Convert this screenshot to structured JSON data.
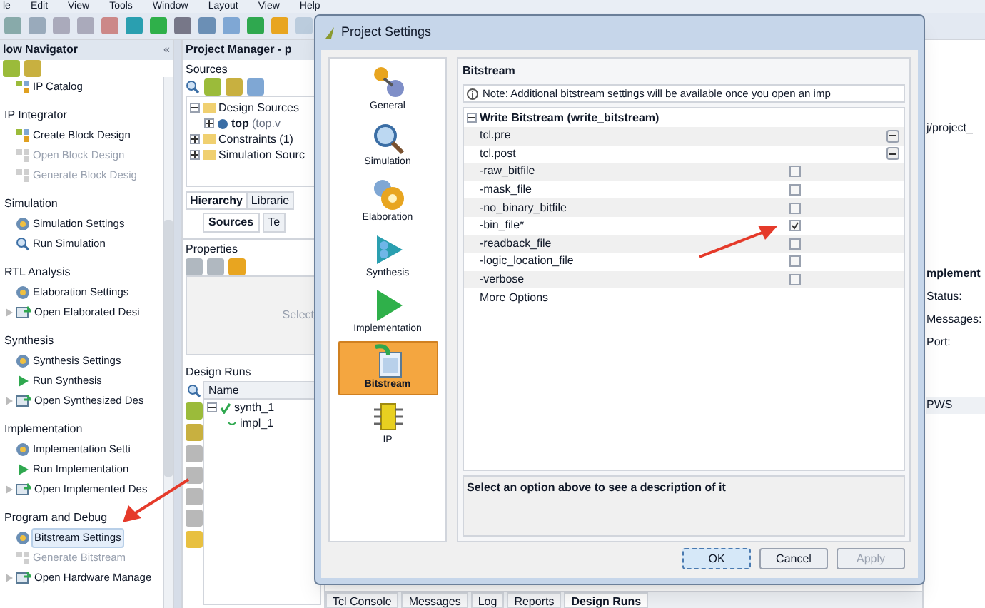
{
  "menu": [
    "le",
    "Edit",
    "View",
    "Tools",
    "Window",
    "Layout",
    "View",
    "Help"
  ],
  "flow_navigator": {
    "title": "low Navigator",
    "collapse": "«",
    "sections": [
      {
        "items": [
          {
            "label": "IP Catalog",
            "kind": "block",
            "disabled": false,
            "selected": false,
            "expandable": false
          }
        ]
      },
      {
        "title": "IP Integrator",
        "items": [
          {
            "label": "Create Block Design",
            "kind": "block",
            "disabled": false,
            "selected": false,
            "expandable": false
          },
          {
            "label": "Open Block Design",
            "kind": "block",
            "disabled": true,
            "selected": false,
            "expandable": false
          },
          {
            "label": "Generate Block Desig",
            "kind": "block",
            "disabled": true,
            "selected": false,
            "expandable": false
          }
        ]
      },
      {
        "title": "Simulation",
        "items": [
          {
            "label": "Simulation Settings",
            "kind": "settings",
            "disabled": false,
            "selected": false,
            "expandable": false
          },
          {
            "label": "Run Simulation",
            "kind": "search",
            "disabled": false,
            "selected": false,
            "expandable": false
          }
        ]
      },
      {
        "title": "RTL Analysis",
        "items": [
          {
            "label": "Elaboration Settings",
            "kind": "settings",
            "disabled": false,
            "selected": false,
            "expandable": false
          },
          {
            "label": "Open Elaborated Desi",
            "kind": "open",
            "disabled": false,
            "selected": false,
            "expandable": true
          }
        ]
      },
      {
        "title": "Synthesis",
        "items": [
          {
            "label": "Synthesis Settings",
            "kind": "settings",
            "disabled": false,
            "selected": false,
            "expandable": false
          },
          {
            "label": "Run Synthesis",
            "kind": "run",
            "disabled": false,
            "selected": false,
            "expandable": false
          },
          {
            "label": "Open Synthesized Des",
            "kind": "open",
            "disabled": false,
            "selected": false,
            "expandable": true
          }
        ]
      },
      {
        "title": "Implementation",
        "items": [
          {
            "label": "Implementation Setti",
            "kind": "settings",
            "disabled": false,
            "selected": false,
            "expandable": false
          },
          {
            "label": "Run Implementation",
            "kind": "run",
            "disabled": false,
            "selected": false,
            "expandable": false
          },
          {
            "label": "Open Implemented Des",
            "kind": "open",
            "disabled": false,
            "selected": false,
            "expandable": true
          }
        ]
      },
      {
        "title": "Program and Debug",
        "items": [
          {
            "label": "Bitstream Settings",
            "kind": "settings",
            "disabled": false,
            "selected": true,
            "expandable": false
          },
          {
            "label": "Generate Bitstream",
            "kind": "block",
            "disabled": true,
            "selected": false,
            "expandable": false
          },
          {
            "label": "Open Hardware Manage",
            "kind": "open",
            "disabled": false,
            "selected": false,
            "expandable": true
          }
        ]
      }
    ]
  },
  "project_manager": {
    "title": "Project Manager - p",
    "sources": {
      "title": "Sources",
      "tree": [
        {
          "label": "Design Sources",
          "expanded": true,
          "children": [
            {
              "label": "top",
              "detail": "(top.v"
            }
          ]
        },
        {
          "label": "Constraints (1)",
          "expanded": false
        },
        {
          "label": "Simulation Sourc",
          "expanded": false
        }
      ],
      "tabs": [
        {
          "label": "Hierarchy",
          "selected": true
        },
        {
          "label": "Librarie",
          "selected": false
        }
      ],
      "subtabs": [
        {
          "label": "Sources",
          "selected": true
        },
        {
          "label": "Te",
          "selected": false
        }
      ]
    },
    "properties": {
      "title": "Properties",
      "hint": "Select"
    },
    "design_runs": {
      "title": "Design Runs",
      "column": "Name",
      "runs": [
        {
          "name": "synth_1",
          "done": true,
          "children": [
            {
              "name": "impl_1",
              "done": false
            }
          ]
        }
      ]
    }
  },
  "bottom_tabs": [
    {
      "label": "Tcl Console",
      "selected": false
    },
    {
      "label": "Messages",
      "selected": false
    },
    {
      "label": "Log",
      "selected": false
    },
    {
      "label": "Reports",
      "selected": false
    },
    {
      "label": "Design Runs",
      "selected": true
    }
  ],
  "right_panel": {
    "path": "j/project_",
    "heading": "mplement",
    "fields": [
      "Status:",
      "Messages:",
      "Port:"
    ],
    "column": "PWS"
  },
  "dialog": {
    "title": "Project Settings",
    "categories": [
      {
        "label": "General",
        "kind": "general",
        "selected": false
      },
      {
        "label": "Simulation",
        "kind": "simulation",
        "selected": false
      },
      {
        "label": "Elaboration",
        "kind": "elaboration",
        "selected": false
      },
      {
        "label": "Synthesis",
        "kind": "synthesis",
        "selected": false
      },
      {
        "label": "Implementation",
        "kind": "implementation",
        "selected": false
      },
      {
        "label": "Bitstream",
        "kind": "bitstream",
        "selected": true
      },
      {
        "label": "IP",
        "kind": "ip",
        "selected": false
      }
    ],
    "page_title": "Bitstream",
    "note": "Note: Additional bitstream settings will be available once you open an imp",
    "group": {
      "title": "Write Bitstream (write_bitstream)",
      "expanded": true,
      "options": [
        {
          "label": "tcl.pre",
          "kind": "browse"
        },
        {
          "label": "tcl.post",
          "kind": "browse"
        },
        {
          "label": "-raw_bitfile",
          "kind": "checkbox",
          "checked": false
        },
        {
          "label": "-mask_file",
          "kind": "checkbox",
          "checked": false
        },
        {
          "label": "-no_binary_bitfile",
          "kind": "checkbox",
          "checked": false
        },
        {
          "label": "-bin_file*",
          "kind": "checkbox",
          "checked": true
        },
        {
          "label": "-readback_file",
          "kind": "checkbox",
          "checked": false
        },
        {
          "label": "-logic_location_file",
          "kind": "checkbox",
          "checked": false
        },
        {
          "label": "-verbose",
          "kind": "checkbox",
          "checked": false
        },
        {
          "label": "More Options",
          "kind": "more"
        }
      ]
    },
    "description": "Select an option above to see a description of it",
    "buttons": [
      {
        "label": "OK",
        "disabled": false,
        "default": true
      },
      {
        "label": "Cancel",
        "disabled": false,
        "default": false
      },
      {
        "label": "Apply",
        "disabled": true,
        "default": false
      }
    ]
  }
}
